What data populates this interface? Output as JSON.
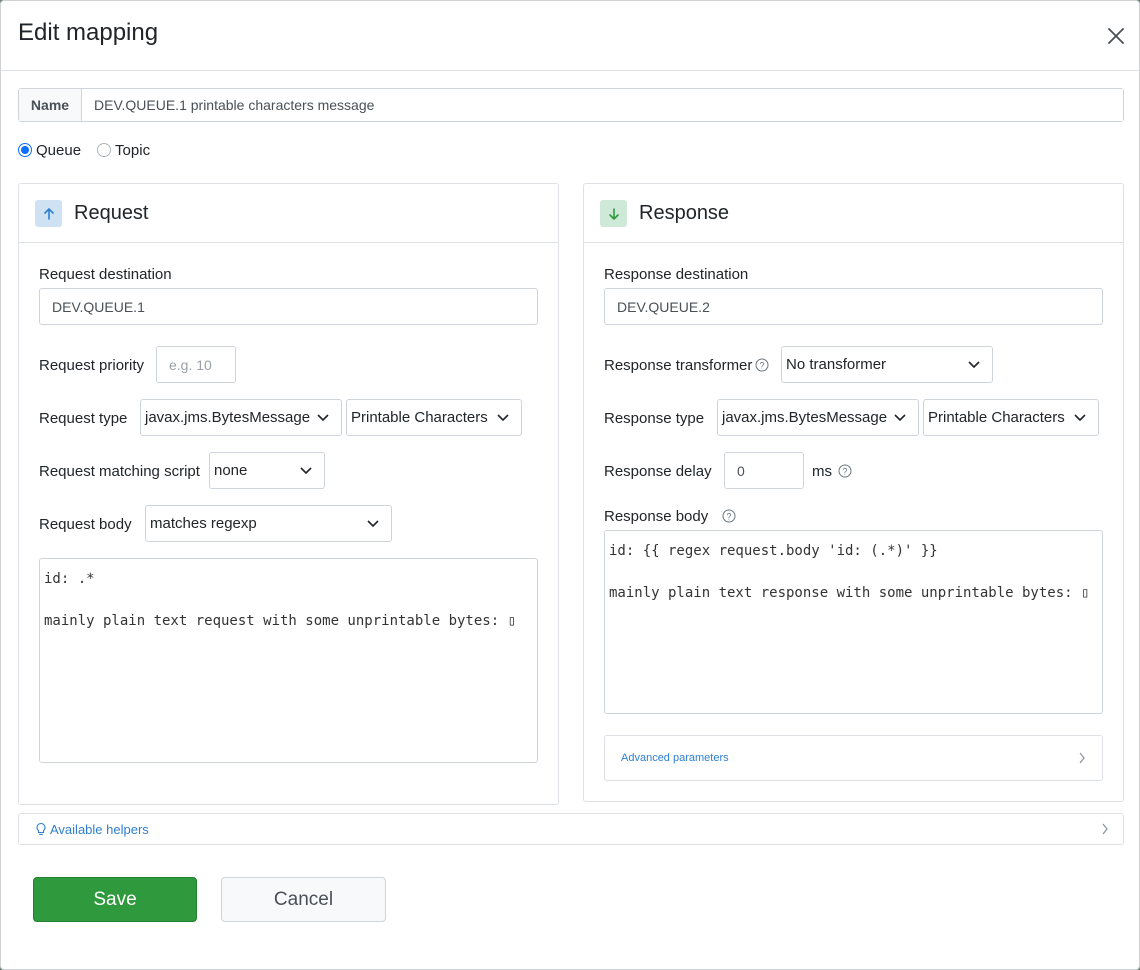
{
  "modal": {
    "title": "Edit mapping"
  },
  "name": {
    "label": "Name",
    "value": "DEV.QUEUE.1 printable characters message"
  },
  "destination_type": {
    "options": [
      {
        "label": "Queue",
        "checked": true
      },
      {
        "label": "Topic",
        "checked": false
      }
    ]
  },
  "request": {
    "title": "Request",
    "icon": "arrow-up-icon",
    "destination_label": "Request destination",
    "destination_value": "DEV.QUEUE.1",
    "priority_label": "Request priority",
    "priority_placeholder": "e.g. 10",
    "type_label": "Request type",
    "type_value": "javax.jms.BytesMessage",
    "encoding_value": "Printable Characters",
    "matching_script_label": "Request matching script",
    "matching_script_value": "none",
    "body_label": "Request body",
    "body_match_value": "matches regexp",
    "body_text": "id: .*\n\nmainly plain text request with some unprintable bytes: ▯"
  },
  "response": {
    "title": "Response",
    "icon": "arrow-down-icon",
    "destination_label": "Response destination",
    "destination_value": "DEV.QUEUE.2",
    "transformer_label": "Response transformer",
    "transformer_value": "No transformer",
    "type_label": "Response type",
    "type_value": "javax.jms.BytesMessage",
    "encoding_value": "Printable Characters",
    "delay_label": "Response delay",
    "delay_value": "0",
    "delay_unit": "ms",
    "body_label": "Response body",
    "body_text": "id: {{ regex request.body 'id: (.*)' }}\n\nmainly plain text response with some unprintable bytes: ▯",
    "advanced_label": "Advanced parameters"
  },
  "helpers": {
    "label": "Available helpers",
    "icon": "lightbulb-icon"
  },
  "buttons": {
    "save": "Save",
    "cancel": "Cancel"
  },
  "colors": {
    "primary": "#0d6efd",
    "save": "#2e9a3d",
    "link": "#2f7fd1"
  }
}
